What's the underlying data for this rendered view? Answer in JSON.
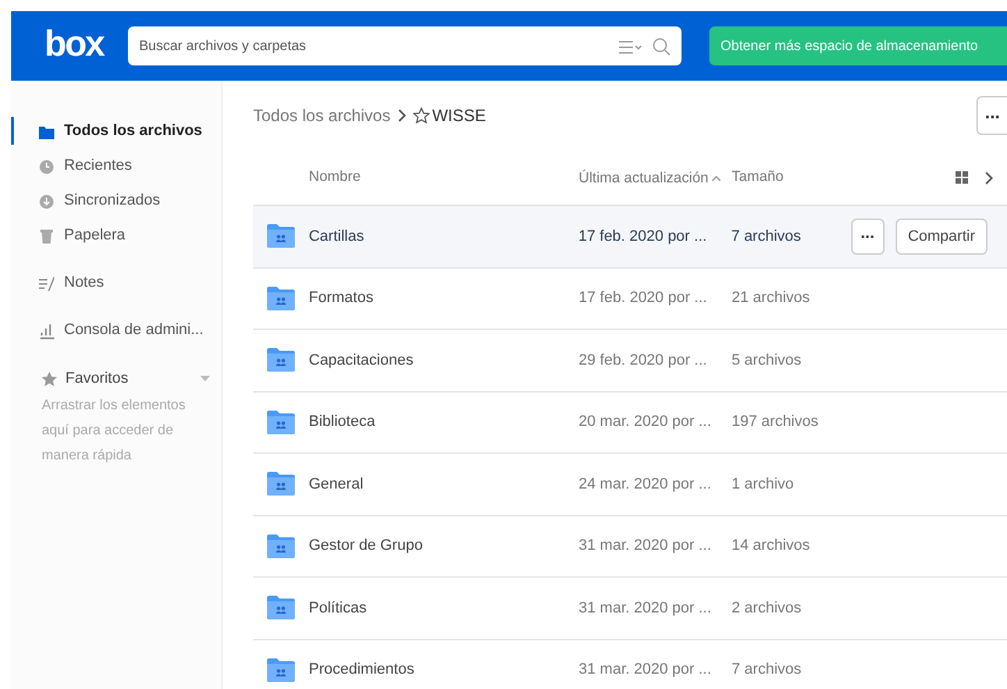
{
  "header": {
    "logo": "box",
    "search": {
      "placeholder": "Buscar archivos y carpetas"
    },
    "upgrade_button": "Obtener más espacio de almacenamiento"
  },
  "sidebar": {
    "items": [
      {
        "label": "Todos los archivos",
        "selected": true
      },
      {
        "label": "Recientes",
        "selected": false
      },
      {
        "label": "Sincronizados",
        "selected": false
      },
      {
        "label": "Papelera",
        "selected": false
      },
      {
        "label": "Notes",
        "selected": false
      },
      {
        "label": "Consola de admini...",
        "selected": false
      }
    ],
    "favorites": {
      "label": "Favoritos",
      "hint": "Arrastrar los elementos aquí para acceder de manera rápida"
    }
  },
  "breadcrumb": [
    "Todos los archivos",
    "WISSE"
  ],
  "more_button": "...",
  "table": {
    "columns": [
      "Nombre",
      "Última actualización",
      "Tamaño"
    ],
    "rows": [
      {
        "name": "Cartillas",
        "updated": "17 feb. 2020 por ...",
        "size": "7 archivos",
        "hovered": true,
        "more": "...",
        "share": "Compartir"
      },
      {
        "name": "Formatos",
        "updated": "17 feb. 2020 por ...",
        "size": "21 archivos",
        "hovered": false
      },
      {
        "name": "Capacitaciones",
        "updated": "29 feb. 2020 por ...",
        "size": "5 archivos",
        "hovered": false
      },
      {
        "name": "Biblioteca",
        "updated": "20 mar. 2020 por ...",
        "size": "197 archivos",
        "hovered": false
      },
      {
        "name": "General",
        "updated": "24 mar. 2020 por ...",
        "size": "1 archivo",
        "hovered": false
      },
      {
        "name": "Gestor de Grupo",
        "updated": "31 mar. 2020 por ...",
        "size": "14 archivos",
        "hovered": false
      },
      {
        "name": "Políticas",
        "updated": "31 mar. 2020 por ...",
        "size": "2 archivos",
        "hovered": false
      },
      {
        "name": "Procedimientos",
        "updated": "31 mar. 2020 por ...",
        "size": "7 archivos",
        "hovered": false
      }
    ]
  }
}
